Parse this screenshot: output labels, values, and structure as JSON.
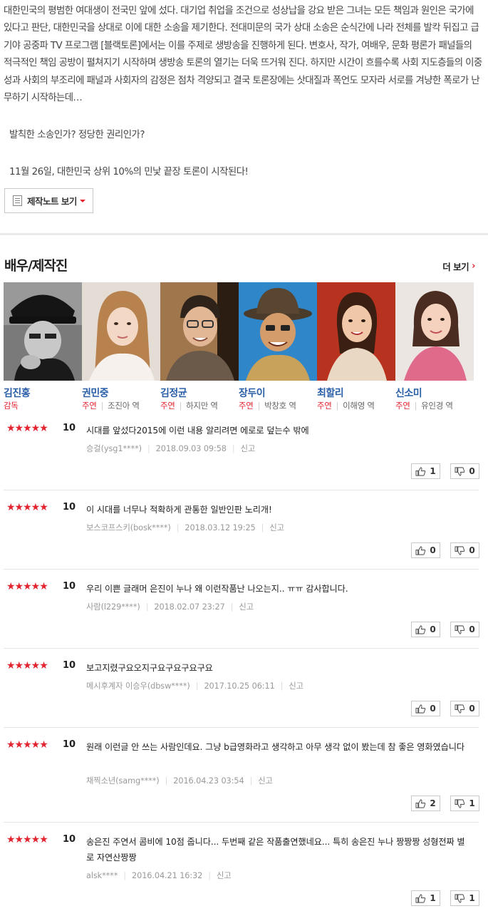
{
  "synopsis": "대한민국의 평범한 여대생이 전국민 앞에 섰다. 대기업 취업을 조건으로 성상납을 강요 받은 그녀는 모든 책임과 원인은 국가에 있다고 판단, 대한민국을 상대로 이에 대한 소송을 제기한다. 전대미문의 국가 상대 소송은 순식간에 나라 전체를 발칵 뒤집고 급기야 공중파 TV 프로그램 [블랙토론]에서는 이를 주제로 생방송을 진행하게 된다. 변호사, 작가, 여배우, 문화 평론가 패널들의 적극적인 책임 공방이 펼쳐지기 시작하며 생방송 토론의 열기는 더욱 뜨거워 진다. 하지만 시간이 흐를수록 사회 지도층들의 이중성과 사회의 부조리에 패널과 사회자의 감정은 점차 격양되고 결국 토론장에는 삿대질과 폭언도 모자라 서로를 겨냥한 폭로가 난무하기 시작하는데…",
  "question1": "발칙한 소송인가? 정당한 권리인가?",
  "question2": "11월 26일, 대한민국 상위 10%의 민낯 끝장 토론이 시작된다!",
  "note_button": "제작노트 보기",
  "section_title": "배우/제작진",
  "more_label": "더 보기",
  "cast": [
    {
      "name": "김진홍",
      "role": "감독",
      "character": ""
    },
    {
      "name": "권민중",
      "role": "주연",
      "character": "조진아 역"
    },
    {
      "name": "김정균",
      "role": "주연",
      "character": "하지만 역"
    },
    {
      "name": "장두이",
      "role": "주연",
      "character": "박창호 역"
    },
    {
      "name": "최할리",
      "role": "주연",
      "character": "이해영 역"
    },
    {
      "name": "신소미",
      "role": "주연",
      "character": "유인경 역"
    }
  ],
  "reviews": [
    {
      "stars": "★★★★★",
      "score": "10",
      "text": "시대를 앞섰다2015에 이런 내용 알리려면 에로로 덮는수 밖에",
      "author": "승걸(ysg1****)",
      "date": "2018.09.03 09:58",
      "report": "신고",
      "up": "1",
      "down": "0"
    },
    {
      "stars": "★★★★★",
      "score": "10",
      "text": "이 시대를 너무나 적확하게 관통한 일반인판 노리개!",
      "author": "보스코프스키(bosk****)",
      "date": "2018.03.12 19:25",
      "report": "신고",
      "up": "0",
      "down": "0"
    },
    {
      "stars": "★★★★★",
      "score": "10",
      "text": "우리 이쁜 글래머 은진이 누나 왜 이런작품난 나오는지.. ㅠㅠ 감사합니다.",
      "author": "사람(l229****)",
      "date": "2018.02.07 23:27",
      "report": "신고",
      "up": "0",
      "down": "0"
    },
    {
      "stars": "★★★★★",
      "score": "10",
      "text": "보고지렸구요오지구요구요구요구요",
      "author": "메시후계자 이승우(dbsw****)",
      "date": "2017.10.25 06:11",
      "report": "신고",
      "up": "0",
      "down": "0"
    },
    {
      "stars": "★★★★★",
      "score": "10",
      "text": "원래 이런글 안 쓰는 사람인데요. 그냥 b급영화라고 생각하고 아무 생각 없이 봤는데 참 좋은 영화였습니다",
      "author": "채찍소년(samg****)",
      "date": "2016.04.23 03:54",
      "report": "신고",
      "up": "2",
      "down": "1"
    },
    {
      "stars": "★★★★★",
      "score": "10",
      "text": "송은진 주연서 콤비에 10점 줍니다... 두번째 같은 작품출연했네요... 특히 송은진 누나 짱짱짱 성형전짜 별로 자연산짱짱",
      "author": "alsk****",
      "date": "2016.04.21 16:32",
      "report": "신고",
      "up": "1",
      "down": "1"
    }
  ]
}
